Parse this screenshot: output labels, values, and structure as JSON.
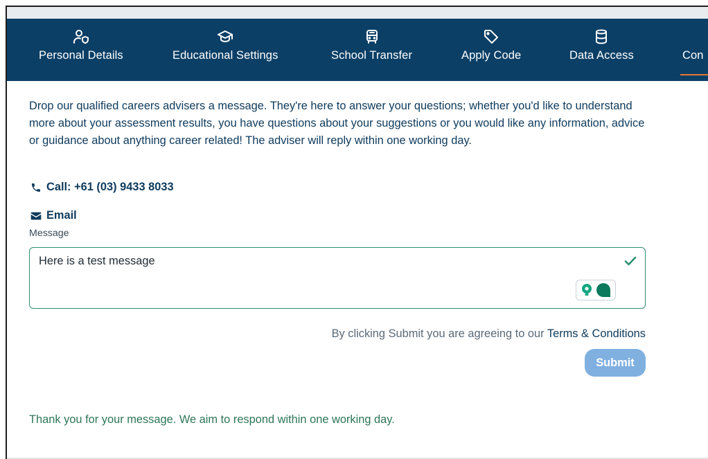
{
  "nav": {
    "items": [
      {
        "label": "Personal Details",
        "icon": "user-shield-icon"
      },
      {
        "label": "Educational Settings",
        "icon": "graduation-cap-icon"
      },
      {
        "label": "School Transfer",
        "icon": "bus-icon"
      },
      {
        "label": "Apply Code",
        "icon": "tag-icon"
      },
      {
        "label": "Data Access",
        "icon": "database-icon"
      },
      {
        "label": "Con",
        "icon": ""
      }
    ],
    "active_index": 5
  },
  "contact": {
    "intro": "Drop our qualified careers advisers a message. They're here to answer your questions; whether you'd like to understand more about your assessment results, you have questions about your suggestions or you would like any information, advice or guidance about anything career related! The adviser will reply within one working day.",
    "call_label": "Call: +61 (03) 9433 8033",
    "email_label": "Email",
    "message_label": "Message",
    "message_value": "Here is a test message",
    "terms_prefix": "By clicking Submit you are agreeing to our ",
    "terms_link": "Terms & Conditions",
    "submit_label": "Submit",
    "thanks_message": "Thank you for your message. We aim to respond within one working day."
  },
  "colors": {
    "nav_bg": "#0b3f66",
    "accent_orange": "#e8772e",
    "valid_green": "#2f8f6d",
    "submit_bg": "#7fb0e0",
    "text_navy": "#0e3a5c"
  }
}
